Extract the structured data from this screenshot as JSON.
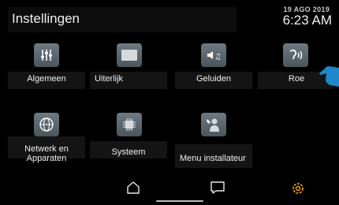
{
  "header": {
    "title": "Instellingen",
    "date": "19 AGO 2019",
    "time": "6:23 AM"
  },
  "tiles": [
    {
      "label": "Algemeen",
      "icon": "sliders-icon"
    },
    {
      "label": "Uiterlijk",
      "icon": "display-icon"
    },
    {
      "label": "Geluiden",
      "icon": "sound-icon"
    },
    {
      "label": "Roe",
      "icon": "call-sound-icon"
    },
    {
      "label": "Netwerk en Apparaten",
      "icon": "network-globe-icon"
    },
    {
      "label": "Systeem",
      "icon": "chip-icon"
    },
    {
      "label": "Menu installateur",
      "icon": "installer-icon"
    }
  ],
  "nav": {
    "items": [
      "home-icon",
      "chat-icon",
      "settings-icon"
    ],
    "active": "settings-icon",
    "accent": "#f2a900"
  },
  "colors": {
    "background": "#000000",
    "tile_icon": "#5f6b73",
    "hand": "#1e88c8"
  }
}
